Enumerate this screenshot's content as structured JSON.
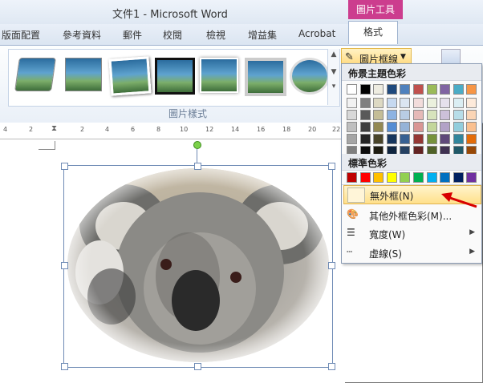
{
  "window": {
    "title": "文件1 - Microsoft Word",
    "context_group": "圖片工具"
  },
  "tabs": [
    "版面配置",
    "參考資料",
    "郵件",
    "校閱",
    "檢視",
    "增益集",
    "Acrobat"
  ],
  "active_tab": "格式",
  "ribbon": {
    "group_label": "圖片樣式",
    "picture_border_button": "圖片框線",
    "gallery_count": 7
  },
  "ruler": {
    "ticks": [
      "4",
      "2",
      "",
      "2",
      "4",
      "6",
      "8",
      "10",
      "12",
      "14",
      "16",
      "18",
      "20",
      "22"
    ]
  },
  "menu": {
    "theme_colors_header": "佈景主題色彩",
    "standard_colors_header": "標準色彩",
    "theme_top_row": [
      "#ffffff",
      "#000000",
      "#eeece1",
      "#1f497d",
      "#4f81bd",
      "#c0504d",
      "#9bbb59",
      "#8064a2",
      "#4bacc6",
      "#f79646"
    ],
    "theme_shades": [
      [
        "#f2f2f2",
        "#7f7f7f",
        "#ddd9c3",
        "#c6d9f0",
        "#dbe5f1",
        "#f2dcdb",
        "#ebf1dd",
        "#e5e0ec",
        "#dbeef3",
        "#fdeada"
      ],
      [
        "#d8d8d8",
        "#595959",
        "#c4bd97",
        "#8db3e2",
        "#b8cce4",
        "#e5b9b7",
        "#d7e3bc",
        "#ccc1d9",
        "#b7dde8",
        "#fbd5b5"
      ],
      [
        "#bfbfbf",
        "#3f3f3f",
        "#938953",
        "#548dd4",
        "#95b3d7",
        "#d99694",
        "#c3d69b",
        "#b2a2c7",
        "#92cddc",
        "#fac08f"
      ],
      [
        "#a5a5a5",
        "#262626",
        "#494429",
        "#17365d",
        "#366092",
        "#953734",
        "#76923c",
        "#5f497a",
        "#31859b",
        "#e36c09"
      ],
      [
        "#7f7f7f",
        "#0c0c0c",
        "#1d1b10",
        "#0f243e",
        "#244061",
        "#632423",
        "#4f6128",
        "#3f3151",
        "#205867",
        "#974806"
      ]
    ],
    "standard_colors": [
      "#c00000",
      "#ff0000",
      "#ffc000",
      "#ffff00",
      "#92d050",
      "#00b050",
      "#00b0f0",
      "#0070c0",
      "#002060",
      "#7030a0"
    ],
    "items": [
      {
        "label": "無外框(N)",
        "icon": "no-outline-swatch",
        "highlighted": true
      },
      {
        "label": "其他外框色彩(M)...",
        "icon": "palette-icon",
        "submenu": false
      },
      {
        "label": "寬度(W)",
        "icon": "line-weight-icon",
        "submenu": true
      },
      {
        "label": "虛線(S)",
        "icon": "dash-icon",
        "submenu": true
      }
    ]
  }
}
